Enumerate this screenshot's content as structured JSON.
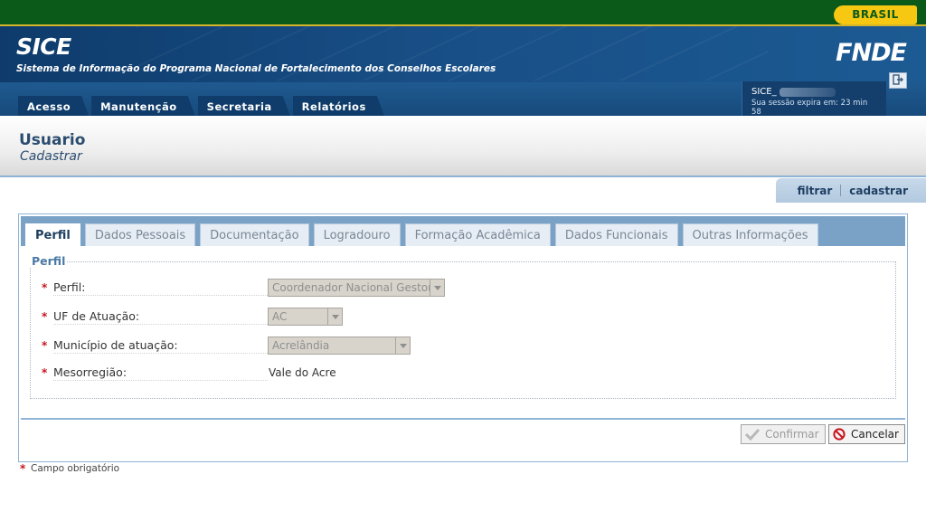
{
  "brand": {
    "gov_label": "BRASIL",
    "fnde_label": "FNDE"
  },
  "header": {
    "app_title": "SICE",
    "app_subtitle": "Sistema de Informação do Programa Nacional de Fortalecimento dos Conselhos Escolares"
  },
  "menu": [
    {
      "label": "Acesso"
    },
    {
      "label": "Manutenção"
    },
    {
      "label": "Secretaria"
    },
    {
      "label": "Relatórios"
    }
  ],
  "session": {
    "user": "SICE_",
    "expires": "Sua sessão expira em: 23 min 58"
  },
  "page": {
    "title": "Usuario",
    "subtitle": "Cadastrar"
  },
  "actions": {
    "filter": "filtrar",
    "create": "cadastrar"
  },
  "tabs": [
    {
      "label": "Perfil",
      "active": true
    },
    {
      "label": "Dados Pessoais"
    },
    {
      "label": "Documentação"
    },
    {
      "label": "Logradouro"
    },
    {
      "label": "Formação Acadêmica"
    },
    {
      "label": "Dados Funcionais"
    },
    {
      "label": "Outras Informações"
    }
  ],
  "form": {
    "legend": "Perfil",
    "fields": {
      "perfil": {
        "label": "Perfil:",
        "value": "Coordenador Nacional Gestor"
      },
      "uf": {
        "label": "UF de Atuação:",
        "value": "AC"
      },
      "municipio": {
        "label": "Município de atuação:",
        "value": "Acrelândia"
      },
      "mesorregiao": {
        "label": "Mesorregião:",
        "value": "Vale do Acre"
      }
    },
    "required_mark": "*",
    "confirm_label": "Confirmar",
    "cancel_label": "Cancelar",
    "required_note": "Campo obrigatório"
  },
  "colors": {
    "gov_green": "#0c5a1a",
    "brand_yellow": "#f6c812",
    "header_blue": "#184e85",
    "required_red": "#c8141c"
  }
}
